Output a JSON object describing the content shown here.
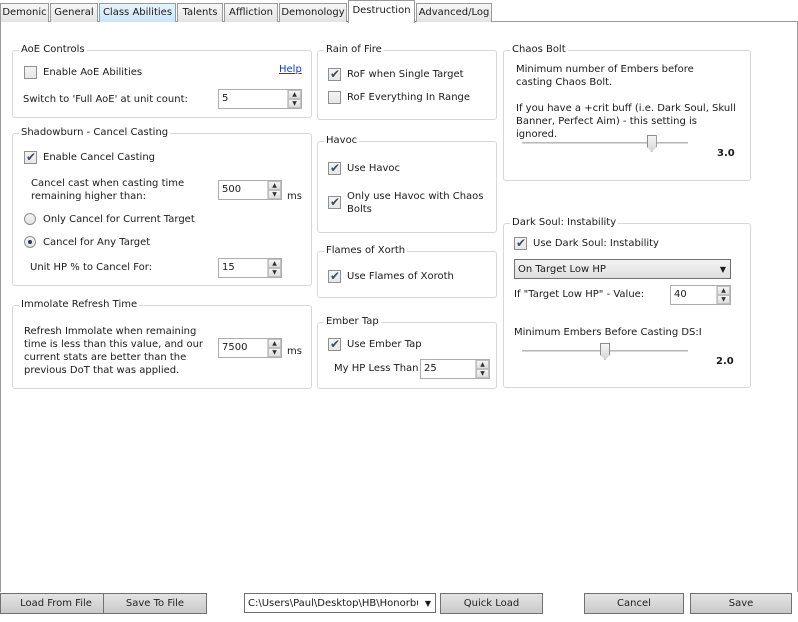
{
  "tabs": [
    "Demonic",
    "General",
    "Class Abilities",
    "Talents",
    "Affliction",
    "Demonology",
    "Destruction",
    "Advanced/Log"
  ],
  "aoe": {
    "title": "AoE Controls",
    "enable_label": "Enable AoE Abilities",
    "help_link": "Help",
    "switch_label": "Switch to 'Full AoE' at unit count:",
    "switch_value": "5"
  },
  "shadowburn": {
    "title": "Shadowburn - Cancel Casting",
    "enable_label": "Enable Cancel Casting",
    "cancel_label": "Cancel cast when casting time remaining higher than:",
    "cancel_value": "500",
    "cancel_unit": "ms",
    "only_current_label": "Only Cancel for Current Target",
    "any_target_label": "Cancel for Any Target",
    "unit_hp_label": "Unit HP % to Cancel For:",
    "unit_hp_value": "15"
  },
  "immolate": {
    "title": "Immolate Refresh Time",
    "desc": "Refresh Immolate when remaining time is less than this value, and our current stats are better than the previous DoT that was applied.",
    "value": "7500",
    "unit": "ms"
  },
  "rain_of_fire": {
    "title": "Rain of Fire",
    "single_label": "RoF when Single Target",
    "everything_label": "RoF Everything In Range"
  },
  "havoc": {
    "title": "Havoc",
    "use_label": "Use Havoc",
    "chaos_label": "Only use Havoc with Chaos Bolts"
  },
  "flames": {
    "title": "Flames of Xorth",
    "use_label": "Use Flames of Xoroth"
  },
  "ember_tap": {
    "title": "Ember Tap",
    "use_label": "Use Ember Tap",
    "hp_label": "My HP Less Than",
    "hp_value": "25"
  },
  "chaos_bolt": {
    "title": "Chaos Bolt",
    "desc1": "Minimum number of Embers before casting Chaos Bolt.",
    "desc2": "If you have a +crit buff (i.e. Dark Soul, Skull Banner, Perfect Aim) - this setting is ignored.",
    "value": "3.0",
    "slider_fraction": 0.8
  },
  "dark_soul": {
    "title": "Dark Soul: Instability",
    "use_label": "Use Dark Soul: Instability",
    "mode_selected": "On Target Low HP",
    "value_label": "If \"Target Low HP\" - Value:",
    "value": "40",
    "min_embers_label": "Minimum Embers Before Casting DS:I",
    "embers_value": "2.0",
    "slider_fraction": 0.5
  },
  "footer": {
    "load_label": "Load From File",
    "save_to_file_label": "Save To File",
    "path_value": "C:\\Users\\Paul\\Desktop\\HB\\Honorbu",
    "quick_load_label": "Quick Load",
    "cancel_label": "Cancel",
    "save_label": "Save"
  }
}
